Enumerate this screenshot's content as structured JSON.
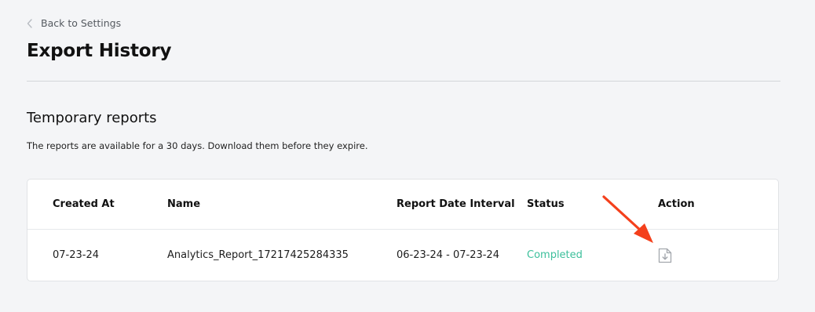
{
  "nav": {
    "back_label": "Back to Settings"
  },
  "page": {
    "title": "Export History"
  },
  "section": {
    "title": "Temporary reports",
    "description": "The reports are available for a 30 days. Download them before they expire."
  },
  "table": {
    "columns": [
      "Created At",
      "Name",
      "Report Date Interval",
      "Status",
      "Action"
    ],
    "rows": [
      {
        "created_at": "07-23-24",
        "name": "Analytics_Report_17217425284335",
        "interval": "06-23-24 - 07-23-24",
        "status": "Completed",
        "action_icon": "download-file-icon"
      }
    ]
  },
  "colors": {
    "background": "#f4f5f7",
    "status_completed": "#3cbf9b",
    "annotation_arrow": "#f4401c"
  }
}
